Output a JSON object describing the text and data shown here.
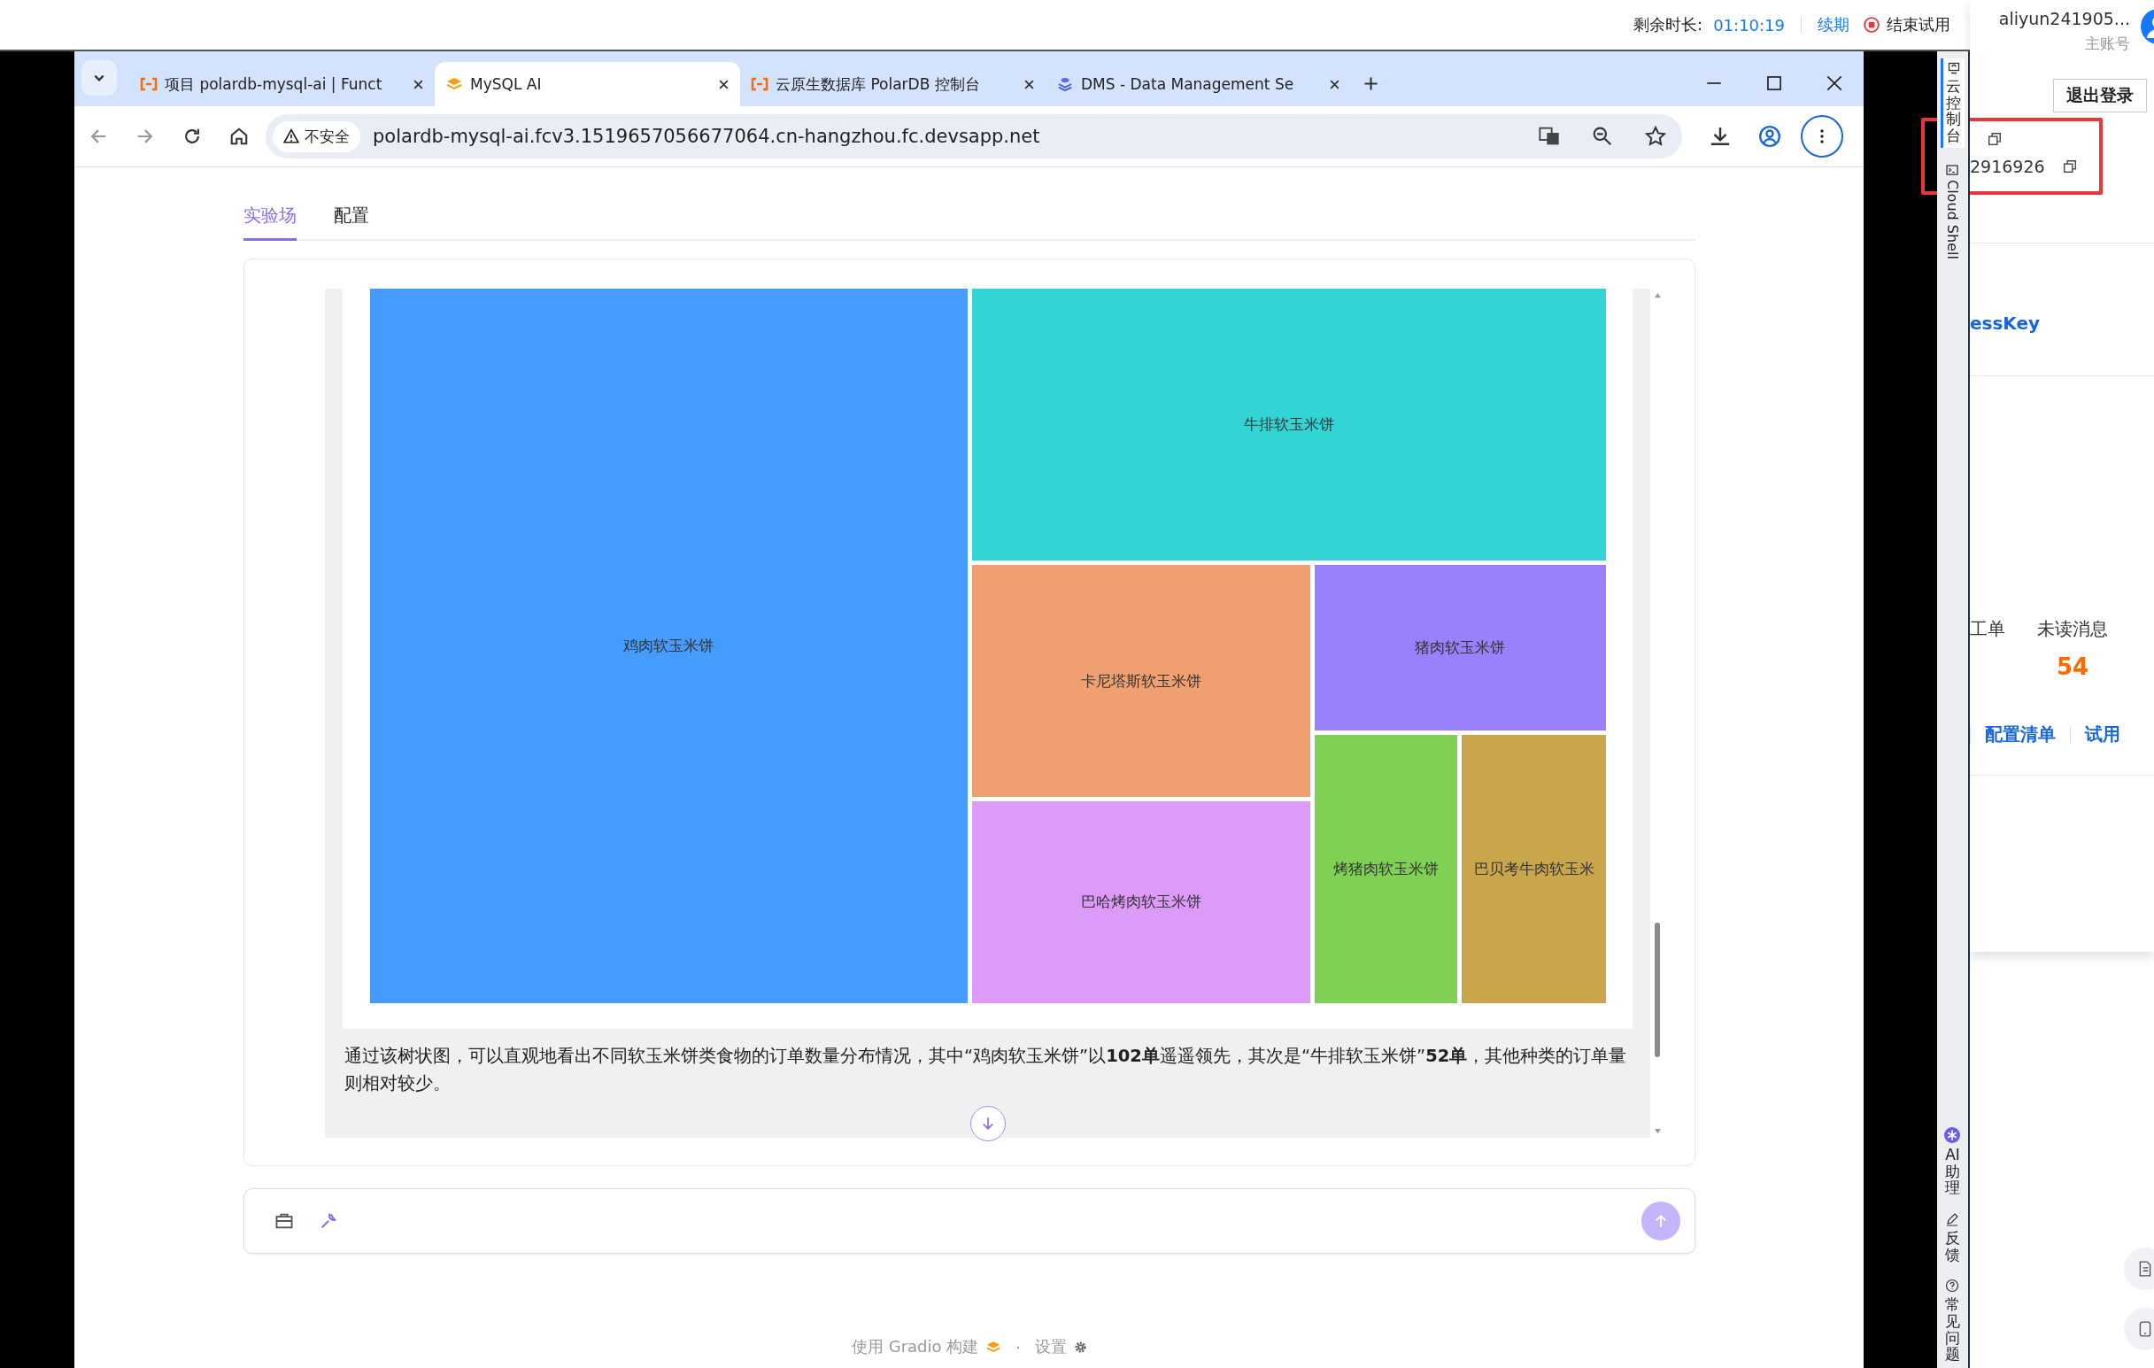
{
  "top_bar": {
    "remaining_label": "剩余时长:",
    "remaining_time": "01:10:19",
    "renew_link": "续期",
    "end_trial": "结束试用"
  },
  "browser": {
    "tabs": [
      {
        "title": "项目 polardb-mysql-ai | Funct",
        "selected": false
      },
      {
        "title": "MySQL AI",
        "selected": true
      },
      {
        "title": "云原生数据库 PolarDB 控制台",
        "selected": false
      },
      {
        "title": "DMS - Data Management Se",
        "selected": false
      }
    ],
    "address": {
      "security": "不安全",
      "url": "polardb-mysql-ai.fcv3.1519657056677064.cn-hangzhou.fc.devsapp.net"
    }
  },
  "page": {
    "tabs": [
      {
        "label": "实验场",
        "selected": true
      },
      {
        "label": "配置",
        "selected": false
      }
    ],
    "treemap": {
      "tiles": [
        {
          "label": "鸡肉软玉米饼",
          "color": "#459cfd"
        },
        {
          "label": "牛排软玉米饼",
          "color": "#33d4d4"
        },
        {
          "label": "卡尼塔斯软玉米饼",
          "color": "#f0a070"
        },
        {
          "label": "猪肉软玉米饼",
          "color": "#9a80fc"
        },
        {
          "label": "巴哈烤肉软玉米饼",
          "color": "#dd9bf9"
        },
        {
          "label": "烤猪肉软玉米饼",
          "color": "#80d055"
        },
        {
          "label": "巴贝考牛肉软玉米",
          "color": "#c9a54c"
        }
      ]
    },
    "message": "通过该树状图，可以直观地看出不同软玉米饼类食物的订单数量分布情况，其中“鸡肉软玉米饼”以**102单**遥遥领先，其次是“牛排软玉米饼”**52单**，其他种类的订单量则相对较少。",
    "footer": {
      "built_with": "使用 Gradio 构建",
      "separator": "·",
      "settings": "设置"
    }
  },
  "side_rail": {
    "top_items": [
      {
        "label": "云控制台",
        "kind": "cjk"
      },
      {
        "label": "Cloud Shell",
        "kind": "latin"
      }
    ],
    "bottom_items": [
      {
        "label": "AI助理",
        "kind": "cjk"
      },
      {
        "label": "反馈",
        "kind": "cjk"
      },
      {
        "label": "常见问题",
        "kind": "cjk"
      }
    ]
  },
  "account_panel": {
    "username": "aliyun241905...",
    "role": "主账号",
    "logout": "退出登录",
    "account_id": "2916926",
    "access_key": "essKey",
    "stats": [
      {
        "label": "工单"
      },
      {
        "label": "未读消息",
        "value": "54"
      }
    ],
    "links": [
      "配置清单",
      "试用"
    ]
  }
}
